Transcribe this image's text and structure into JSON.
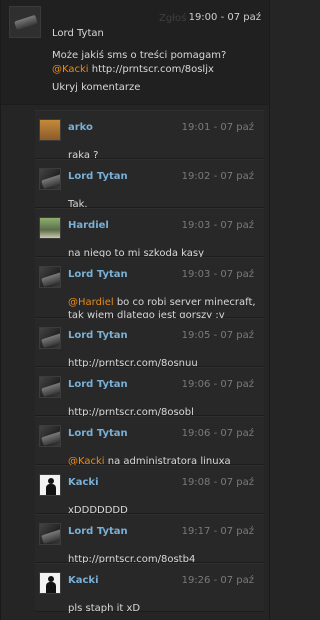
{
  "top_comment": {
    "report_label": "Zgłoś",
    "time": "19:00 - 07 paź",
    "author": "Lord Tytan",
    "text_before": "Może jakiś sms o treści pomagam? ",
    "mention": "@Kacki",
    "text_after": " http://prntscr.com/8osljx",
    "hide_label": "Ukryj komentarze",
    "avatar_icon": "phone-avatar"
  },
  "colors": {
    "accent_author": "#7ab0d6",
    "mention": "#e88a1a"
  },
  "replies": [
    {
      "author": "arko",
      "time": "19:01 - 07 paź",
      "pre": "",
      "mention": "",
      "text": "raka ?",
      "avatar": "arko"
    },
    {
      "author": "Lord Tytan",
      "time": "19:02 - 07 paź",
      "pre": "",
      "mention": "",
      "text": "Tak.",
      "avatar": "phone"
    },
    {
      "author": "Hardiel",
      "time": "19:03 - 07 paź",
      "pre": "",
      "mention": "",
      "text": "na niego to mi szkoda kasy",
      "avatar": "hardiel"
    },
    {
      "author": "Lord Tytan",
      "time": "19:03 - 07 paź",
      "pre": "",
      "mention": "@Hardiel",
      "text": " bo co robi server minecraft, tak wiem dlatego jest gorszy :v",
      "avatar": "phone"
    },
    {
      "author": "Lord Tytan",
      "time": "19:05 - 07 paź",
      "pre": "",
      "mention": "",
      "text": "http://prntscr.com/8osnuu",
      "avatar": "phone"
    },
    {
      "author": "Lord Tytan",
      "time": "19:06 - 07 paź",
      "pre": "",
      "mention": "",
      "text": "http://prntscr.com/8osobl",
      "avatar": "phone"
    },
    {
      "author": "Lord Tytan",
      "time": "19:06 - 07 paź",
      "pre": "",
      "mention": "@Kacki",
      "text": " na administratora linuxa",
      "avatar": "phone"
    },
    {
      "author": "Kacki",
      "time": "19:08 - 07 paź",
      "pre": "",
      "mention": "",
      "text": "xDDDDDDD",
      "avatar": "silhouette"
    },
    {
      "author": "Lord Tytan",
      "time": "19:17 - 07 paź",
      "pre": "",
      "mention": "",
      "text": "http://prntscr.com/8ostb4",
      "avatar": "phone"
    },
    {
      "author": "Kacki",
      "time": "19:26 - 07 paź",
      "pre": "",
      "mention": "",
      "text": "pls staph it xD",
      "avatar": "silhouette"
    }
  ]
}
